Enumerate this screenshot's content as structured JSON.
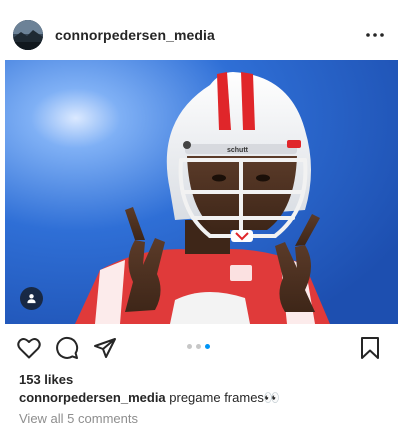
{
  "post": {
    "username": "connorpedersen_media",
    "avatar_icon": "profile-avatar",
    "more_icon": "more-horizontal-icon",
    "photo_alt": "Football player in white helmet and red jersey making hand signs against a blue background",
    "helmet_brand": "schutt",
    "tag_icon": "user-tag-icon",
    "carousel": {
      "total": 3,
      "active_index": 3
    },
    "likes_text": "153 likes",
    "caption": {
      "username": "connorpedersen_media",
      "text": " pregame frames👀"
    },
    "comments_link": "View all 5 comments"
  },
  "icons": {
    "like": "heart-icon",
    "comment": "comment-icon",
    "share": "send-icon",
    "save": "bookmark-icon"
  },
  "colors": {
    "background": "#ffffff",
    "text": "#262626",
    "muted": "#8e8e8e",
    "accent": "#0095f6",
    "sky_blue": "#2f6fd6",
    "jersey_red": "#e03a3a"
  }
}
